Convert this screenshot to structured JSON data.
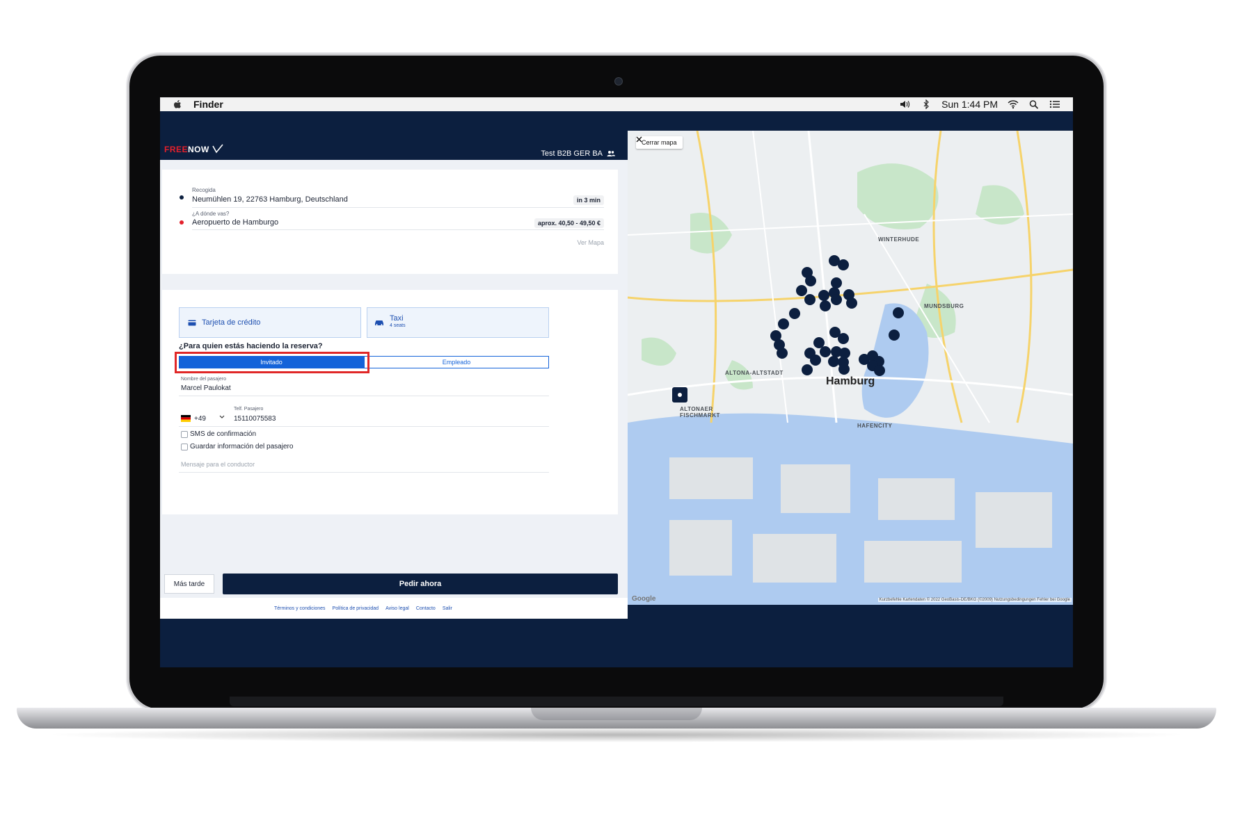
{
  "menubar": {
    "app": "Finder",
    "time": "Sun 1:44 PM"
  },
  "header": {
    "logo_free": "FREE",
    "logo_now": "NOW",
    "account": "Test B2B GER BA"
  },
  "route": {
    "pickup_label": "Recogida",
    "pickup_value": "Neumühlen 19, 22763 Hamburg, Deutschland",
    "pickup_eta": "in 3 min",
    "dest_label": "¿A dónde vas?",
    "dest_value": "Aeropuerto de Hamburgo",
    "dest_price": "aprox. 40,50 - 49,50 €",
    "view_map": "Ver Mapa"
  },
  "payment": {
    "label": "Tarjeta de crédito"
  },
  "vehicle": {
    "label": "Taxi",
    "seats": "4 seats"
  },
  "booking_for": {
    "question": "¿Para quien estás haciendo la reserva?",
    "option_guest": "Invitado",
    "option_employee": "Empleado",
    "selected": "Invitado"
  },
  "passenger": {
    "name_label": "Nombre del pasajero",
    "name_value": "Marcel  Paulokat",
    "country_code": "+49",
    "phone_label": "Telf. Pasajero",
    "phone_value": "15110075583",
    "sms_label": "SMS de confirmación",
    "save_label": "Guardar información del pasajero",
    "message_placeholder": "Mensaje para el conductor"
  },
  "actions": {
    "later": "Más tarde",
    "order_now": "Pedir ahora"
  },
  "footer": {
    "links": [
      "Términos y condiciones",
      "Política de privacidad",
      "Aviso legal",
      "Contacto",
      "Salir"
    ]
  },
  "map": {
    "close_label": "Cerrar mapa",
    "city": "Hamburg",
    "districts": [
      "WINTERHUDE",
      "ALTONA-ALTSTADT",
      "HAFENCITY",
      "ALTONAER FISCHMARKT",
      "MUNDSBURG"
    ],
    "google": "Google",
    "attribution": "Kurzbefehle   Kartendaten © 2022 GeoBasis-DE/BKG (©2009)   Nutzungsbedingungen   Fehler bei Google"
  },
  "colors": {
    "brand_navy": "#0c1f3f",
    "brand_red": "#e3202b",
    "accent_blue": "#1463d9",
    "highlight_red": "#e02727"
  }
}
